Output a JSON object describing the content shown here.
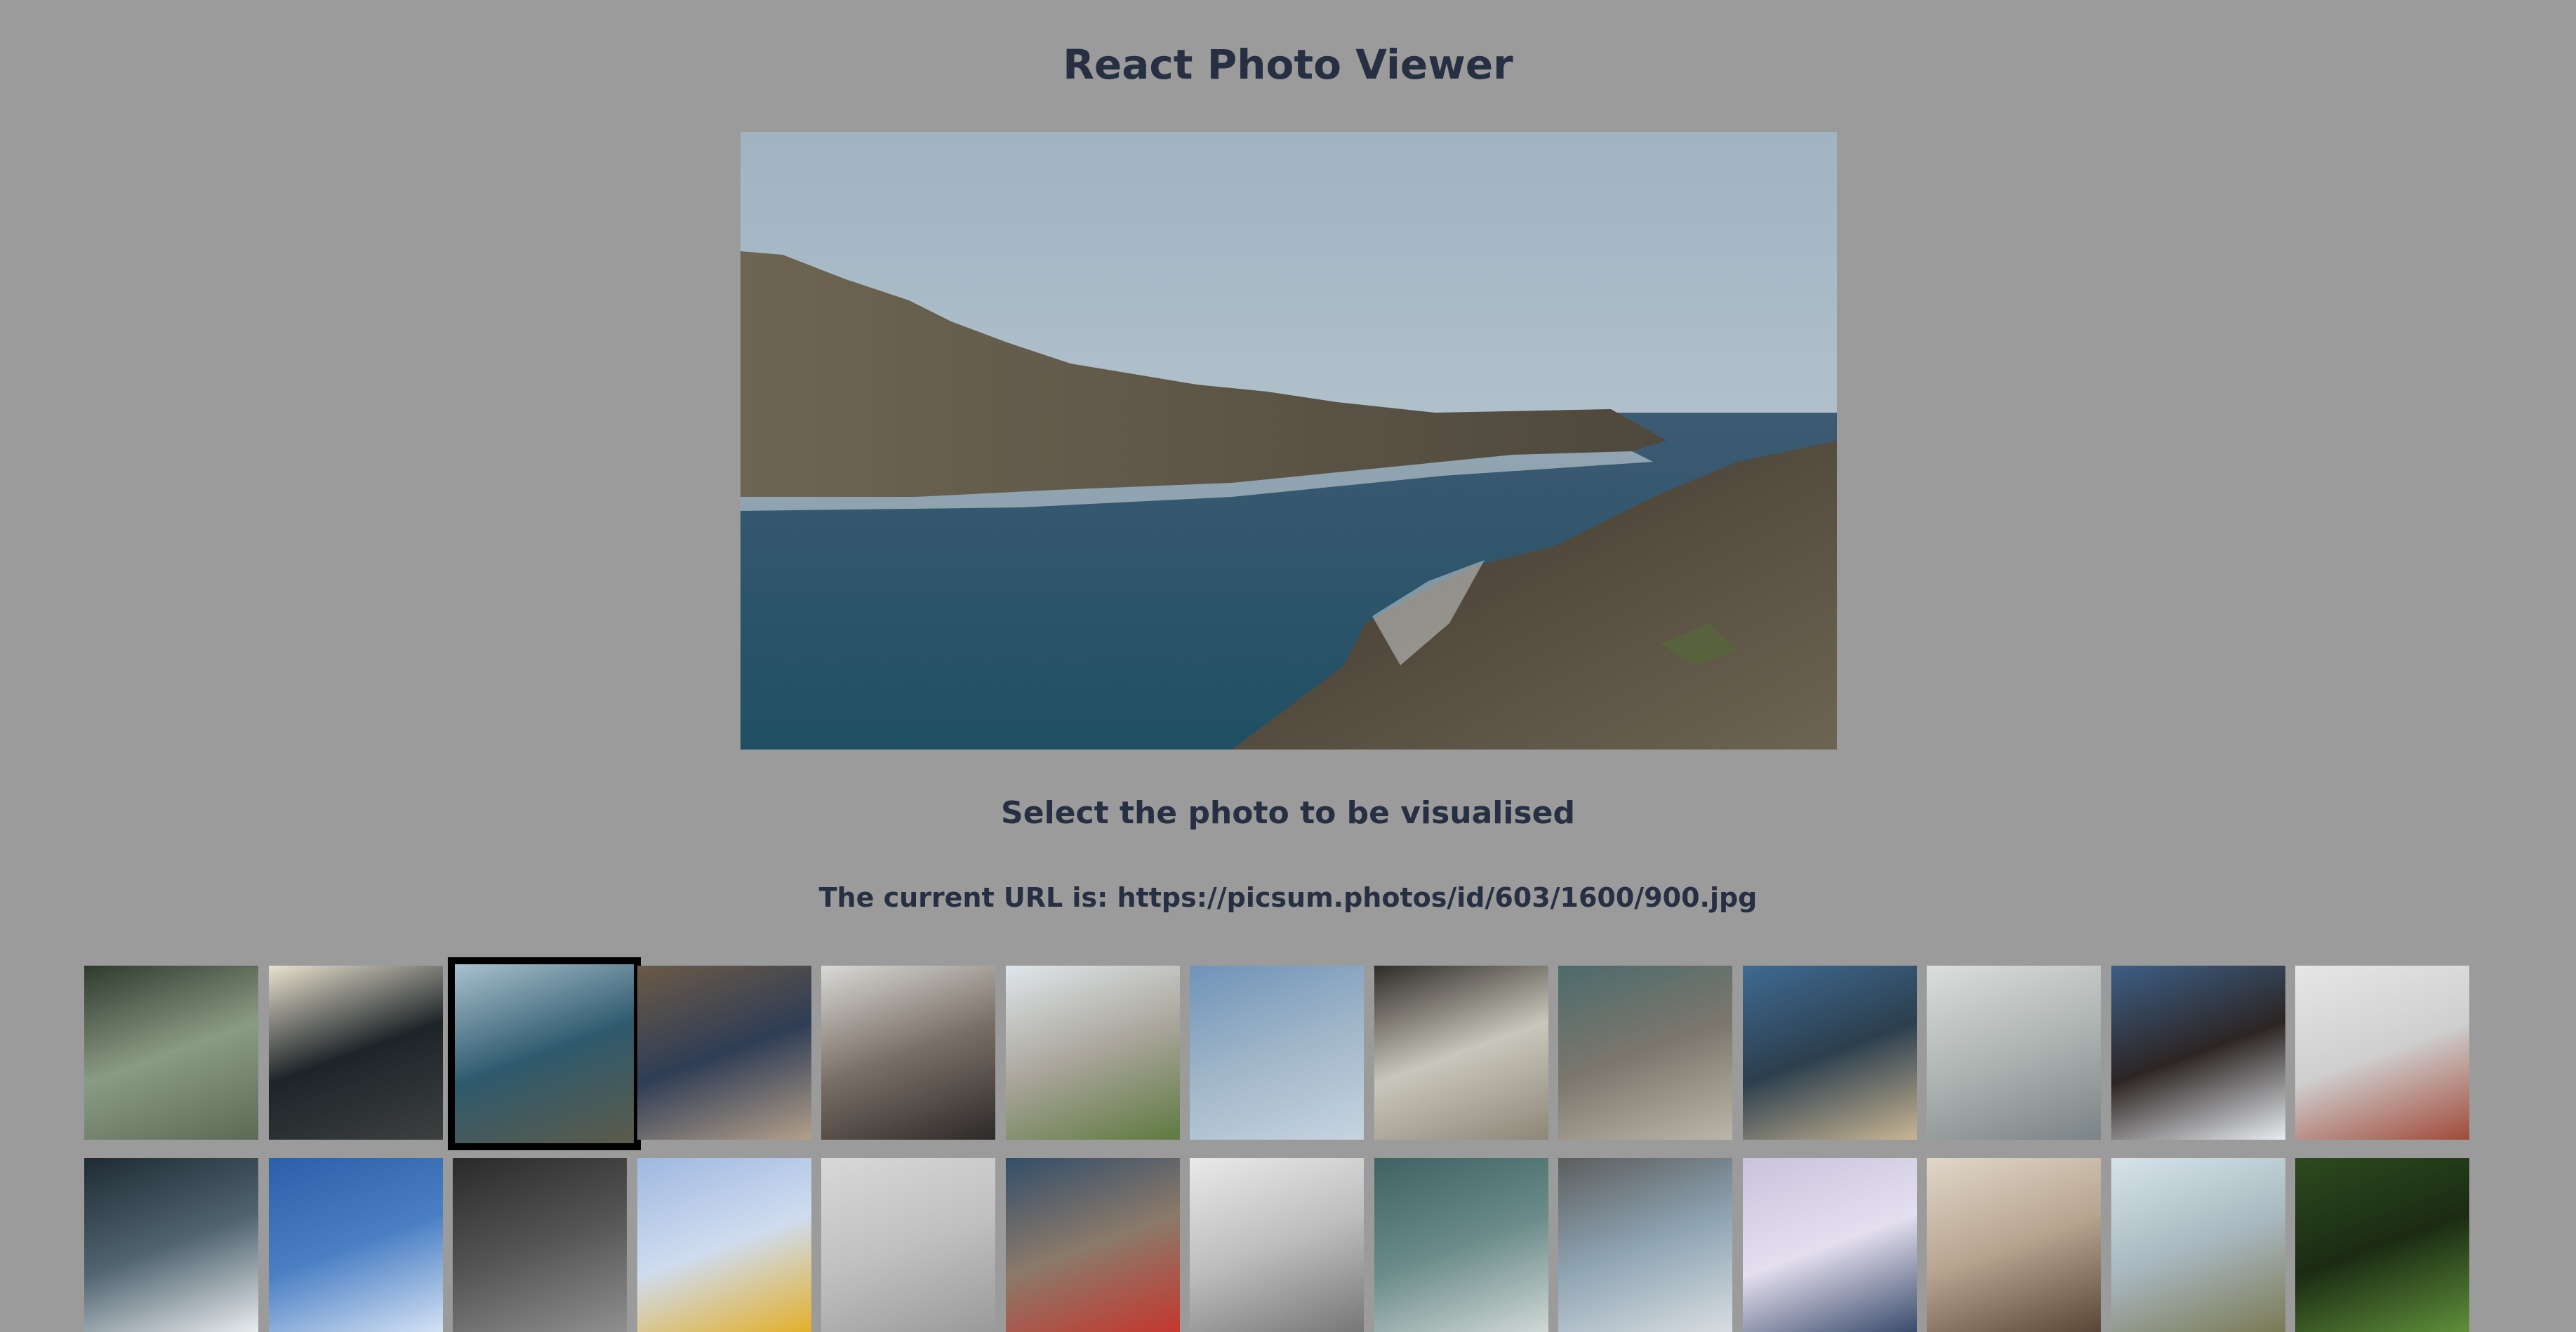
{
  "app": {
    "title": "React Photo Viewer"
  },
  "viewer": {
    "main_photo_alt": "Rocky coastline with blue sea",
    "select_label": "Select the photo to be visualised",
    "url_prefix": "The current URL is: ",
    "current_url": "https://picsum.photos/id/603/1600/900.jpg"
  },
  "thumbnails": [
    {
      "name": "thumb-forest",
      "selected": false,
      "colors": [
        "#2f3a2e",
        "#5b6a55",
        "#8a9b84"
      ]
    },
    {
      "name": "thumb-person-sunset",
      "selected": false,
      "colors": [
        "#e9e2cf",
        "#3d4041",
        "#1d2428"
      ]
    },
    {
      "name": "thumb-coast",
      "selected": true,
      "colors": [
        "#a9c1cf",
        "#5c5b4a",
        "#2e5a6d"
      ]
    },
    {
      "name": "thumb-legs-boat",
      "selected": false,
      "colors": [
        "#6b5a47",
        "#b39f8a",
        "#2f3d55"
      ]
    },
    {
      "name": "thumb-car-interior",
      "selected": false,
      "colors": [
        "#d9d9d6",
        "#2d2a29",
        "#7a6f66"
      ]
    },
    {
      "name": "thumb-boardwalk-beach",
      "selected": false,
      "colors": [
        "#dfe6ea",
        "#5f7a40",
        "#a9a59b"
      ]
    },
    {
      "name": "thumb-sky-clouds",
      "selected": false,
      "colors": [
        "#6f93b8",
        "#c6d4e0",
        "#a0b6c9"
      ]
    },
    {
      "name": "thumb-pier-under",
      "selected": false,
      "colors": [
        "#2f2b27",
        "#8d8779",
        "#c9c6bb"
      ]
    },
    {
      "name": "thumb-pebbles",
      "selected": false,
      "colors": [
        "#4c6b6b",
        "#bcb6aa",
        "#7d776d"
      ]
    },
    {
      "name": "thumb-beach-grass",
      "selected": false,
      "colors": [
        "#3f6a92",
        "#c8b593",
        "#2c3f4e"
      ]
    },
    {
      "name": "thumb-seagulls",
      "selected": false,
      "colors": [
        "#dadedd",
        "#7a8386",
        "#aeb4b2"
      ]
    },
    {
      "name": "thumb-wave-rock",
      "selected": false,
      "colors": [
        "#3d5f86",
        "#e9edf1",
        "#2c2524"
      ]
    },
    {
      "name": "thumb-bridge",
      "selected": false,
      "colors": [
        "#e6e6e6",
        "#a14a3a",
        "#cfcfcf"
      ]
    },
    {
      "name": "thumb-waves-dark",
      "selected": false,
      "colors": [
        "#1f2b33",
        "#e8ecef",
        "#516470"
      ]
    },
    {
      "name": "thumb-blue-sky",
      "selected": false,
      "colors": [
        "#2b5fa8",
        "#d4e2f4",
        "#4a7fc4"
      ]
    },
    {
      "name": "thumb-tunnel",
      "selected": false,
      "colors": [
        "#2a2a2a",
        "#8f8f8f",
        "#555555"
      ]
    },
    {
      "name": "thumb-crane",
      "selected": false,
      "colors": [
        "#9fb8e0",
        "#e3b02b",
        "#cfdcef"
      ]
    },
    {
      "name": "thumb-glass-roof",
      "selected": false,
      "colors": [
        "#d8d8d8",
        "#9a9a9a",
        "#c0c0c0"
      ]
    },
    {
      "name": "thumb-phone-booth",
      "selected": false,
      "colors": [
        "#334e6a",
        "#c5372e",
        "#8b7a6a"
      ]
    },
    {
      "name": "thumb-arch",
      "selected": false,
      "colors": [
        "#e9e9e9",
        "#777777",
        "#bdbdbd"
      ]
    },
    {
      "name": "thumb-glass-building",
      "selected": false,
      "colors": [
        "#3e6363",
        "#d0d8d6",
        "#6a8b89"
      ]
    },
    {
      "name": "thumb-towers",
      "selected": false,
      "colors": [
        "#5c5e5e",
        "#d7dde1",
        "#8fa4b3"
      ]
    },
    {
      "name": "thumb-bridge-lavender",
      "selected": false,
      "colors": [
        "#c9c3dc",
        "#3a4b6b",
        "#e4dfef"
      ]
    },
    {
      "name": "thumb-room-table",
      "selected": false,
      "colors": [
        "#e0d7c9",
        "#5a4636",
        "#b7a48f"
      ]
    },
    {
      "name": "thumb-cliff-lighthouse",
      "selected": false,
      "colors": [
        "#d6e3ea",
        "#7a7a55",
        "#a9b8c0"
      ]
    },
    {
      "name": "thumb-green-beans",
      "selected": false,
      "colors": [
        "#2d4a1f",
        "#5f8f3a",
        "#1b2b13"
      ]
    }
  ]
}
